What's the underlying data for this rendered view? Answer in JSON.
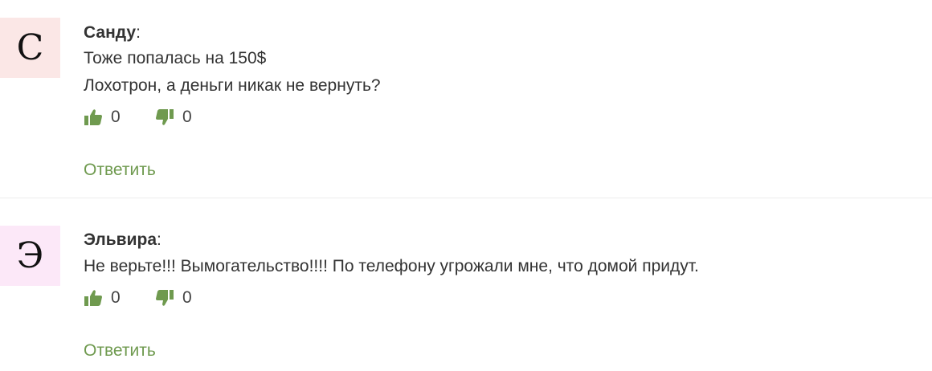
{
  "comments": [
    {
      "avatar_letter": "С",
      "avatar_color": "#fbe7e6",
      "author": "Санду",
      "separator": ":",
      "lines": [
        "Тоже попалась на 150$",
        "Лохотрон, а деньги никак не вернуть?"
      ],
      "likes": "0",
      "dislikes": "0",
      "reply_label": "Ответить"
    },
    {
      "avatar_letter": "Э",
      "avatar_color": "#fce8f8",
      "author": "Эльвира",
      "separator": ":",
      "lines": [
        "Не верьте!!! Вымогательство!!!! По телефону угрожали мне, что домой придут."
      ],
      "likes": "0",
      "dislikes": "0",
      "reply_label": "Ответить"
    }
  ],
  "icons": {
    "like": "thumbs-up-icon",
    "dislike": "thumbs-down-icon",
    "icon_color": "#6f9a4f"
  }
}
